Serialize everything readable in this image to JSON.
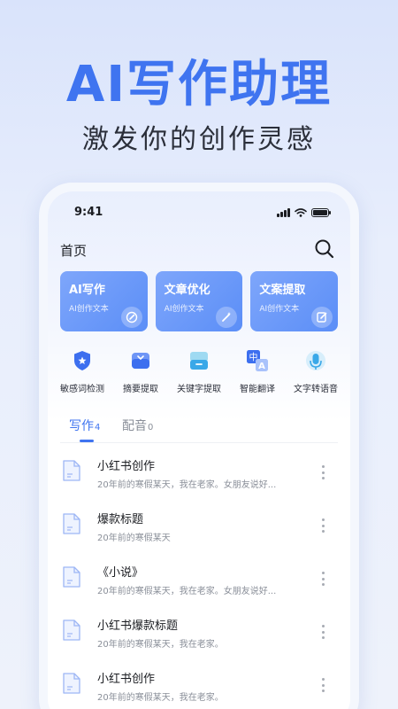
{
  "hero": {
    "title": "AI写作助理",
    "subtitle": "激发你的创作灵感"
  },
  "status": {
    "time": "9:41"
  },
  "nav": {
    "title": "首页",
    "search_icon": "search-icon"
  },
  "cards": [
    {
      "title": "AI写作",
      "subtitle": "AI创作文本",
      "icon": "pen-icon"
    },
    {
      "title": "文章优化",
      "subtitle": "AI创作文本",
      "icon": "magic-wand-icon"
    },
    {
      "title": "文案提取",
      "subtitle": "AI创作文本",
      "icon": "edit-icon"
    }
  ],
  "tools": [
    {
      "label": "敏感词检测",
      "icon": "shield-icon"
    },
    {
      "label": "摘要提取",
      "icon": "tray-icon"
    },
    {
      "label": "关键字提取",
      "icon": "box-icon"
    },
    {
      "label": "智能翻译",
      "icon": "translate-icon"
    },
    {
      "label": "文字转语音",
      "icon": "microphone-icon"
    }
  ],
  "tabs": [
    {
      "label": "写作",
      "count": "4"
    },
    {
      "label": "配音",
      "count": "0"
    }
  ],
  "list": [
    {
      "title": "小红书创作",
      "desc": "20年前的寒假某天，我在老家。女朋友说好..."
    },
    {
      "title": "爆款标题",
      "desc": "20年前的寒假某天"
    },
    {
      "title": "《小说》",
      "desc": "20年前的寒假某天，我在老家。女朋友说好..."
    },
    {
      "title": "小红书爆款标题",
      "desc": "20年前的寒假某天，我在老家。"
    },
    {
      "title": "小红书创作",
      "desc": "20年前的寒假某天，我在老家。"
    }
  ],
  "colors": {
    "accent": "#3f74f0",
    "card_gradient_start": "#7ea6fb",
    "card_gradient_end": "#5b8ef7"
  }
}
